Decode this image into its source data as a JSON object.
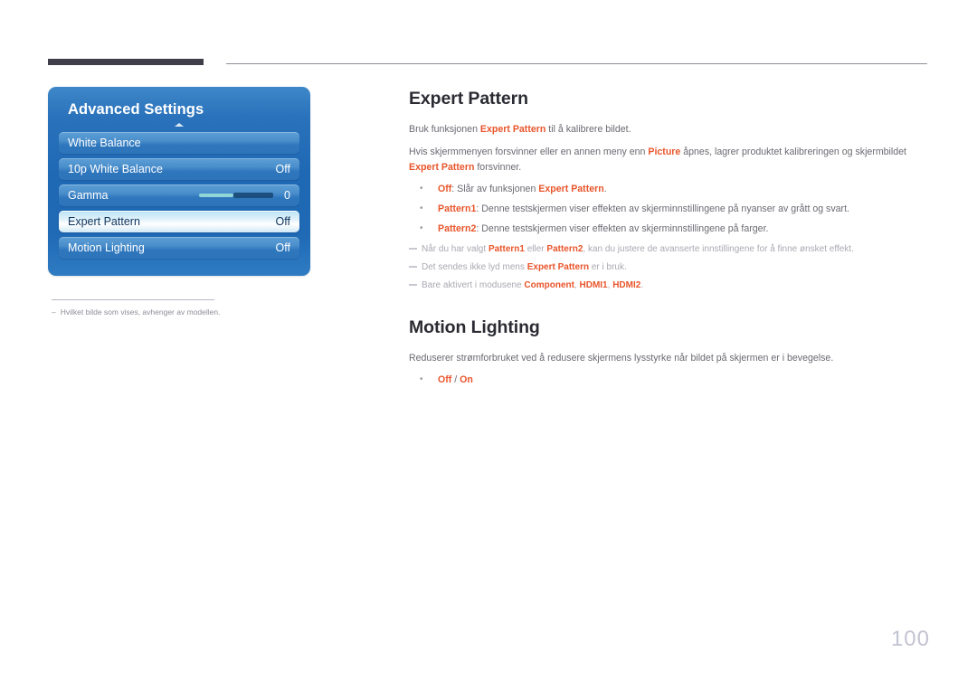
{
  "page": {
    "number": "100"
  },
  "osd": {
    "title": "Advanced Settings",
    "collapse_icon": "caret-up-icon",
    "rows": [
      {
        "label": "White Balance",
        "value": "",
        "selected": false,
        "type": "nav"
      },
      {
        "label": "10p White Balance",
        "value": "Off",
        "selected": false,
        "type": "value"
      },
      {
        "label": "Gamma",
        "value": "0",
        "selected": false,
        "type": "slider"
      },
      {
        "label": "Expert Pattern",
        "value": "Off",
        "selected": true,
        "type": "value"
      },
      {
        "label": "Motion Lighting",
        "value": "Off",
        "selected": false,
        "type": "value"
      }
    ],
    "footnote": {
      "dash": "–",
      "text": "Hvilket bilde som vises, avhenger av modellen."
    }
  },
  "article": {
    "expert_pattern": {
      "heading": "Expert Pattern",
      "p1": {
        "a": "Bruk funksjonen ",
        "b": "Expert Pattern",
        "c": " til å kalibrere bildet."
      },
      "p2": {
        "a": "Hvis skjermmenyen forsvinner eller en annen meny enn ",
        "b": "Picture",
        "c": " åpnes, lagrer produktet kalibreringen og skjermbildet ",
        "d": "Expert Pattern",
        "e": " forsvinner."
      },
      "bullets": [
        {
          "term": "Off",
          "sep": ": Slår av funksjonen ",
          "term2": "Expert Pattern",
          "tail": "."
        },
        {
          "term": "Pattern1",
          "sep": ": Denne testskjermen viser effekten av skjerminnstillingene på nyanser av grått og svart.",
          "term2": "",
          "tail": ""
        },
        {
          "term": "Pattern2",
          "sep": ": Denne testskjermen viser effekten av skjerminnstillingene på farger.",
          "term2": "",
          "tail": ""
        }
      ],
      "notes": [
        {
          "a": "Når du har valgt ",
          "b": "Pattern1",
          "c": " eller ",
          "d": "Pattern2",
          "e": ", kan du justere de avanserte innstillingene for å finne ønsket effekt."
        },
        {
          "a": "Det sendes ikke lyd mens ",
          "b": "Expert Pattern",
          "c": " er i bruk.",
          "d": "",
          "e": ""
        },
        {
          "a": "Bare aktivert i modusene ",
          "b": "Component",
          "c": ", ",
          "d": "HDMI1",
          "e": ", ",
          "f": "HDMI2",
          "g": "."
        }
      ]
    },
    "motion_lighting": {
      "heading": "Motion Lighting",
      "p1": "Reduserer strømforbruket ved å redusere skjermens lysstyrke når bildet på skjermen er i bevegelse.",
      "bullet": {
        "off": "Off",
        "slash": " / ",
        "on": "On"
      }
    }
  },
  "colors": {
    "accent": "#e8552b",
    "rule_dark": "#413e4c",
    "rule_light": "#8e8e96",
    "osd_blue": "#1f68b4",
    "page_num": "#c3c3d2"
  }
}
